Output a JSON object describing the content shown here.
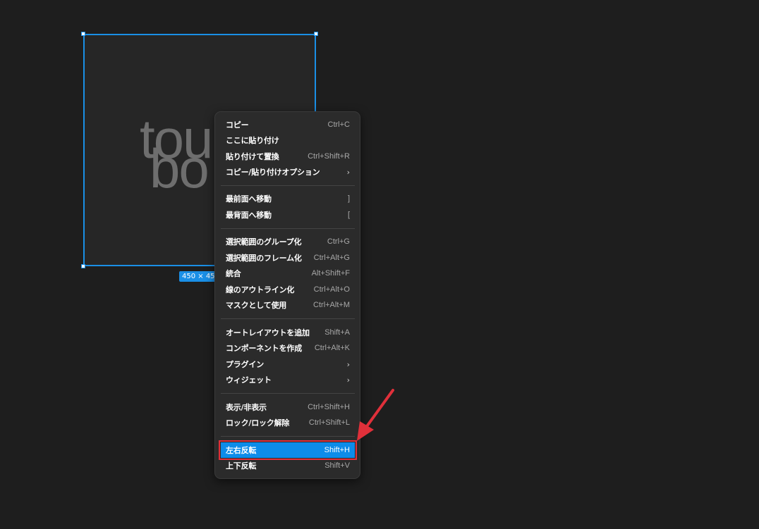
{
  "canvas": {
    "background": "#1e1e1e",
    "selection_color": "#1a8fe6",
    "size_badge": "450 × 450",
    "logo_lines": [
      "tou",
      "bo"
    ]
  },
  "context_menu": {
    "copy": {
      "label": "コピー",
      "shortcut": "Ctrl+C"
    },
    "paste_here": {
      "label": "ここに貼り付け",
      "shortcut": ""
    },
    "paste_replace": {
      "label": "貼り付けて置換",
      "shortcut": "Ctrl+Shift+R"
    },
    "copy_paste_options": {
      "label": "コピー/貼り付けオプション",
      "chevron": "›"
    },
    "bring_to_front": {
      "label": "最前面へ移動",
      "shortcut": "]"
    },
    "send_to_back": {
      "label": "最背面へ移動",
      "shortcut": "["
    },
    "group_selection": {
      "label": "選択範囲のグループ化",
      "shortcut": "Ctrl+G"
    },
    "frame_selection": {
      "label": "選択範囲のフレーム化",
      "shortcut": "Ctrl+Alt+G"
    },
    "flatten": {
      "label": "統合",
      "shortcut": "Alt+Shift+F"
    },
    "outline_stroke": {
      "label": "線のアウトライン化",
      "shortcut": "Ctrl+Alt+O"
    },
    "use_as_mask": {
      "label": "マスクとして使用",
      "shortcut": "Ctrl+Alt+M"
    },
    "add_auto_layout": {
      "label": "オートレイアウトを追加",
      "shortcut": "Shift+A"
    },
    "create_component": {
      "label": "コンポーネントを作成",
      "shortcut": "Ctrl+Alt+K"
    },
    "plugins": {
      "label": "プラグイン",
      "chevron": "›"
    },
    "widgets": {
      "label": "ウィジェット",
      "chevron": "›"
    },
    "show_hide": {
      "label": "表示/非表示",
      "shortcut": "Ctrl+Shift+H"
    },
    "lock_unlock": {
      "label": "ロック/ロック解除",
      "shortcut": "Ctrl+Shift+L"
    },
    "flip_horizontal": {
      "label": "左右反転",
      "shortcut": "Shift+H"
    },
    "flip_vertical": {
      "label": "上下反転",
      "shortcut": "Shift+V"
    }
  },
  "colors": {
    "menu_bg": "#2b2b2b",
    "highlight": "#0d8ce9",
    "annotation_red": "#e0303a"
  }
}
